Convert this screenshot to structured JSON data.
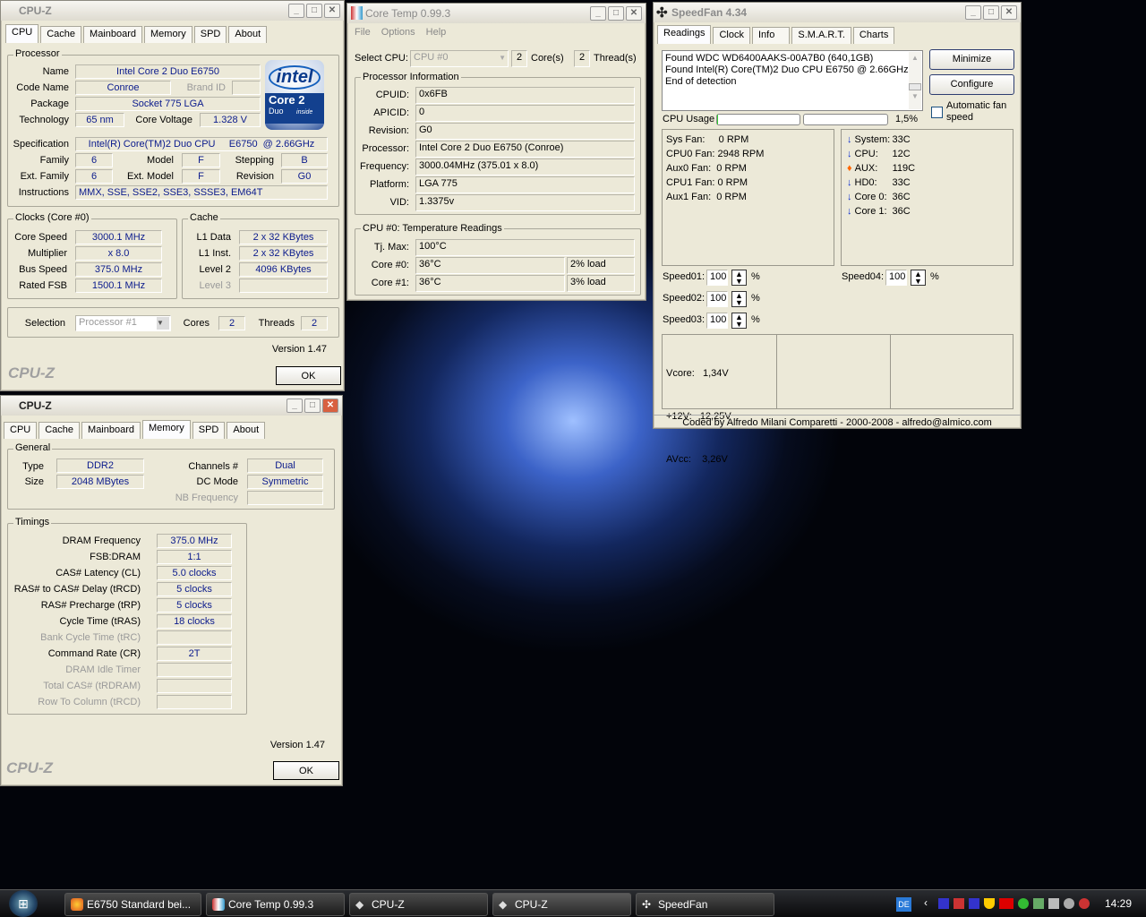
{
  "cpuz1": {
    "title": "CPU-Z",
    "tabs": [
      "CPU",
      "Cache",
      "Mainboard",
      "Memory",
      "SPD",
      "About"
    ],
    "processor": {
      "label": "Processor",
      "name_l": "Name",
      "name": "Intel Core 2 Duo E6750",
      "code_l": "Code Name",
      "code": "Conroe",
      "brand_l": "Brand ID",
      "brand": "",
      "package_l": "Package",
      "package": "Socket 775 LGA",
      "tech_l": "Technology",
      "tech": "65 nm",
      "volt_l": "Core Voltage",
      "volt": "1.328 V",
      "spec_l": "Specification",
      "spec": "Intel(R) Core(TM)2 Duo CPU     E6750  @ 2.66GHz",
      "family_l": "Family",
      "family": "6",
      "model_l": "Model",
      "model": "F",
      "stepping_l": "Stepping",
      "stepping": "B",
      "extfam_l": "Ext. Family",
      "extfam": "6",
      "extmod_l": "Ext. Model",
      "extmod": "F",
      "rev_l": "Revision",
      "rev": "G0",
      "instr_l": "Instructions",
      "instr": "MMX, SSE, SSE2, SSE3, SSSE3, EM64T"
    },
    "logo": {
      "brand": "intel",
      "line1": "Core 2",
      "line2": "Duo",
      "inside": "inside"
    },
    "clocks": {
      "label": "Clocks (Core #0)",
      "core_l": "Core Speed",
      "core": "3000.1 MHz",
      "mult_l": "Multiplier",
      "mult": "x 8.0",
      "bus_l": "Bus Speed",
      "bus": "375.0 MHz",
      "fsb_l": "Rated FSB",
      "fsb": "1500.1 MHz"
    },
    "cache": {
      "label": "Cache",
      "l1d_l": "L1 Data",
      "l1d": "2 x 32 KBytes",
      "l1i_l": "L1 Inst.",
      "l1i": "2 x 32 KBytes",
      "l2_l": "Level 2",
      "l2": "4096 KBytes",
      "l3_l": "Level 3",
      "l3": ""
    },
    "sel": {
      "label": "Selection",
      "value": "Processor #1",
      "cores_l": "Cores",
      "cores": "2",
      "threads_l": "Threads",
      "threads": "2"
    },
    "version": "Version 1.47",
    "brand_text": "CPU-Z",
    "ok": "OK"
  },
  "cpuz2": {
    "title": "CPU-Z",
    "tabs": [
      "CPU",
      "Cache",
      "Mainboard",
      "Memory",
      "SPD",
      "About"
    ],
    "general": {
      "label": "General",
      "type_l": "Type",
      "type": "DDR2",
      "size_l": "Size",
      "size": "2048 MBytes",
      "ch_l": "Channels #",
      "ch": "Dual",
      "dc_l": "DC Mode",
      "dc": "Symmetric",
      "nb_l": "NB Frequency",
      "nb": ""
    },
    "timings": {
      "label": "Timings",
      "rows": [
        {
          "l": "DRAM Frequency",
          "v": "375.0 MHz",
          "on": true
        },
        {
          "l": "FSB:DRAM",
          "v": "1:1",
          "on": true
        },
        {
          "l": "CAS# Latency (CL)",
          "v": "5.0 clocks",
          "on": true
        },
        {
          "l": "RAS# to CAS# Delay (tRCD)",
          "v": "5 clocks",
          "on": true
        },
        {
          "l": "RAS# Precharge (tRP)",
          "v": "5 clocks",
          "on": true
        },
        {
          "l": "Cycle Time (tRAS)",
          "v": "18 clocks",
          "on": true
        },
        {
          "l": "Bank Cycle Time (tRC)",
          "v": "",
          "on": false
        },
        {
          "l": "Command Rate (CR)",
          "v": "2T",
          "on": true
        },
        {
          "l": "DRAM Idle Timer",
          "v": "",
          "on": false
        },
        {
          "l": "Total CAS# (tRDRAM)",
          "v": "",
          "on": false
        },
        {
          "l": "Row To Column (tRCD)",
          "v": "",
          "on": false
        }
      ]
    },
    "version": "Version 1.47",
    "brand_text": "CPU-Z",
    "ok": "OK"
  },
  "coretemp": {
    "title": "Core Temp 0.99.3",
    "menu": [
      "File",
      "Options",
      "Help"
    ],
    "select_l": "Select CPU:",
    "select": "CPU #0",
    "cores": "2",
    "cores_l": "Core(s)",
    "threads": "2",
    "threads_l": "Thread(s)",
    "info_label": "Processor Information",
    "info": [
      {
        "l": "CPUID:",
        "v": "0x6FB"
      },
      {
        "l": "APICID:",
        "v": "0"
      },
      {
        "l": "Revision:",
        "v": "G0"
      },
      {
        "l": "Processor:",
        "v": "Intel Core 2 Duo E6750 (Conroe)"
      },
      {
        "l": "Frequency:",
        "v": "3000.04MHz (375.01 x 8.0)"
      },
      {
        "l": "Platform:",
        "v": "LGA 775"
      },
      {
        "l": "VID:",
        "v": "1.3375v"
      }
    ],
    "temp_label": "CPU #0: Temperature Readings",
    "tj_l": "Tj. Max:",
    "tj": "100°C",
    "c0_l": "Core #0:",
    "c0": "36°C",
    "c0load": "2% load",
    "c1_l": "Core #1:",
    "c1": "36°C",
    "c1load": "3% load"
  },
  "speedfan": {
    "title": "SpeedFan 4.34",
    "tabs": [
      "Readings",
      "Clock",
      "Info",
      "S.M.A.R.T.",
      "Charts"
    ],
    "log": [
      "Found WDC WD6400AAKS-00A7B0 (640,1GB)",
      "Found Intel(R) Core(TM)2 Duo CPU E6750 @ 2.66GHz",
      "End of detection"
    ],
    "minimize": "Minimize",
    "configure": "Configure",
    "auto": "Automatic fan speed",
    "cpu_usage_l": "CPU Usage",
    "cpu_usage": "1,5%",
    "cpu_usage_pct": 1.5,
    "fans": [
      "Sys Fan:     0 RPM",
      "CPU0 Fan: 2948 RPM",
      "Aux0 Fan:  0 RPM",
      "CPU1 Fan: 0 RPM",
      "Aux1 Fan:  0 RPM"
    ],
    "temps": [
      {
        "l": "System:",
        "v": "33C",
        "icon": "arrow-down"
      },
      {
        "l": "CPU:",
        "v": "12C",
        "icon": "arrow-down"
      },
      {
        "l": "AUX:",
        "v": "119C",
        "icon": "flame"
      },
      {
        "l": "HD0:",
        "v": "33C",
        "icon": "arrow-down"
      },
      {
        "l": "Core 0:",
        "v": "36C",
        "icon": "arrow-down"
      },
      {
        "l": "Core 1:",
        "v": "36C",
        "icon": "arrow-down"
      }
    ],
    "speeds": [
      {
        "l": "Speed01:",
        "v": "100"
      },
      {
        "l": "Speed02:",
        "v": "100"
      },
      {
        "l": "Speed03:",
        "v": "100"
      },
      {
        "l": "Speed04:",
        "v": "100"
      }
    ],
    "pct": "%",
    "volts": [
      "Vcore:   1,34V",
      "+12V:   12,25V",
      "AVcc:    3,26V"
    ],
    "footer": "Coded by Alfredo Milani Comparetti - 2000-2008 - alfredo@almico.com"
  },
  "taskbar": {
    "items": [
      "E6750 Standard bei...",
      "Core Temp 0.99.3",
      "CPU-Z",
      "CPU-Z",
      "SpeedFan"
    ],
    "lang": "DE",
    "clock": "14:29"
  }
}
